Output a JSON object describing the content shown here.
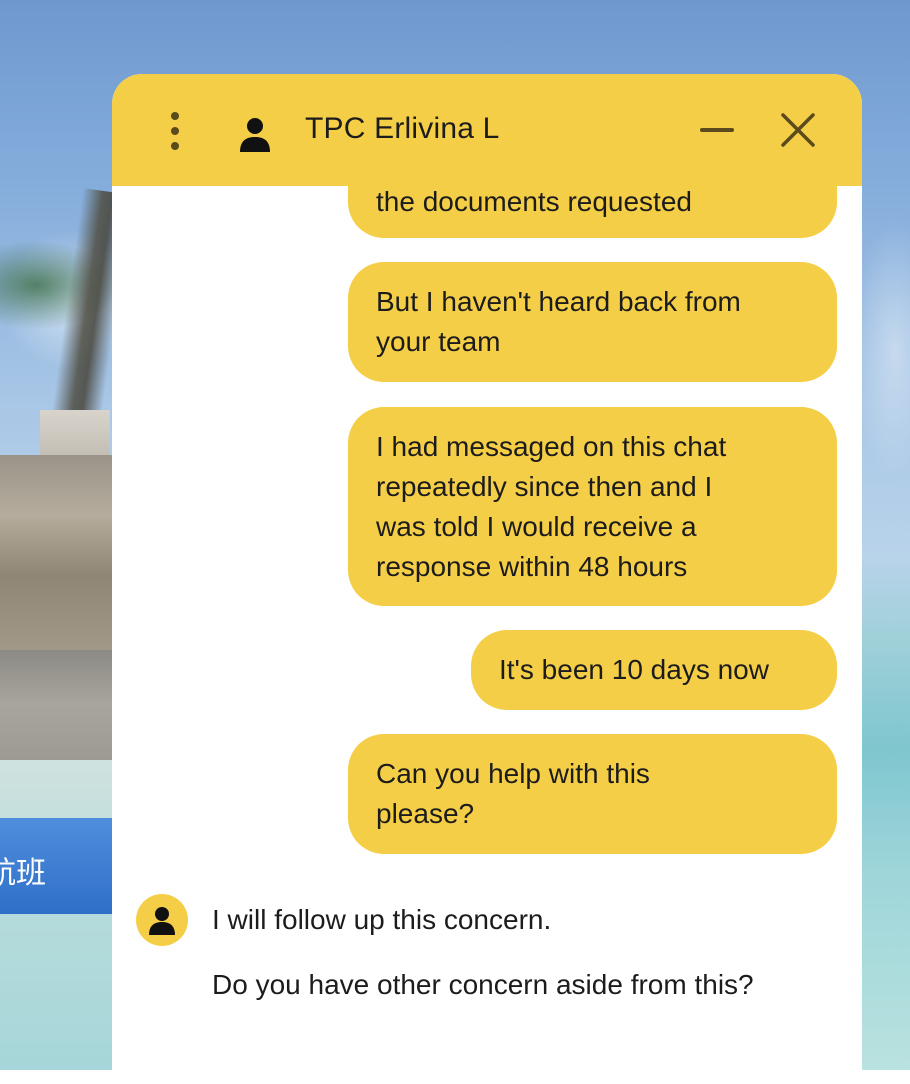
{
  "background": {
    "side_button_label": "航班"
  },
  "chat": {
    "title": "TPC Erlivina L",
    "accent_color": "#f5ce47",
    "icons": {
      "menu": "kebab-menu-icon",
      "agent": "person-icon",
      "minimize": "minimize-icon",
      "close": "close-icon"
    },
    "user_messages": [
      {
        "lines": [
          "the documents requested"
        ]
      },
      {
        "lines": [
          "But I haven't heard back from",
          "your team"
        ]
      },
      {
        "lines": [
          "I had messaged on this chat",
          "repeatedly since then and I",
          "was told I would receive a",
          "response within 48 hours"
        ]
      },
      {
        "lines": [
          "It's been 10 days now"
        ]
      },
      {
        "lines": [
          "Can you help with this",
          "please?"
        ]
      }
    ],
    "agent_messages": [
      {
        "text": "I will follow up this concern."
      },
      {
        "text": "Do you have other concern aside from this?"
      }
    ]
  }
}
